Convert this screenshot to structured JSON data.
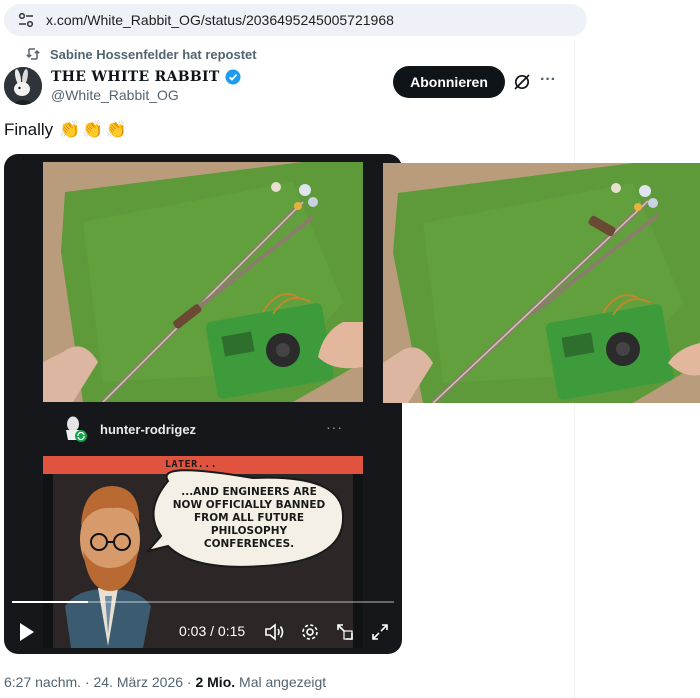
{
  "browser": {
    "url": "x.com/White_Rabbit_OG/status/2036495245005721968",
    "site_icon": "tune-icon"
  },
  "tweet": {
    "repost_text": "Sabine Hossenfelder hat repostet",
    "display_name": "THE WHITE RABBIT",
    "handle": "@White_Rabbit_OG",
    "follow_label": "Abonnieren",
    "more_label": "···",
    "text": "Finally",
    "emoji": [
      "👏",
      "👏",
      "👏"
    ],
    "meta": {
      "time": "6:27 nachm.",
      "sep1": " · ",
      "date": "24. März 2026",
      "sep2": " · ",
      "views": "2 Mio.",
      "views_label": " Mal angezeigt"
    }
  },
  "video": {
    "embedded_user": "hunter-rodrigez",
    "embedded_more": "···",
    "comic_caption": "LATER...",
    "speech_lines": [
      "...AND ENGINEERS ARE",
      "NOW OFFICIALLY BANNED",
      "FROM ALL FUTURE",
      "PHILOSOPHY",
      "CONFERENCES."
    ],
    "current_time": "0:03",
    "time_sep": " / ",
    "duration": "0:15",
    "progress": 0.2
  },
  "colors": {
    "follow_bg": "#0f1419",
    "verified": "#1d9bf0",
    "video_bg": "#15171a",
    "felt_green": "#5e9a3a",
    "comic_red": "#e0543f"
  }
}
